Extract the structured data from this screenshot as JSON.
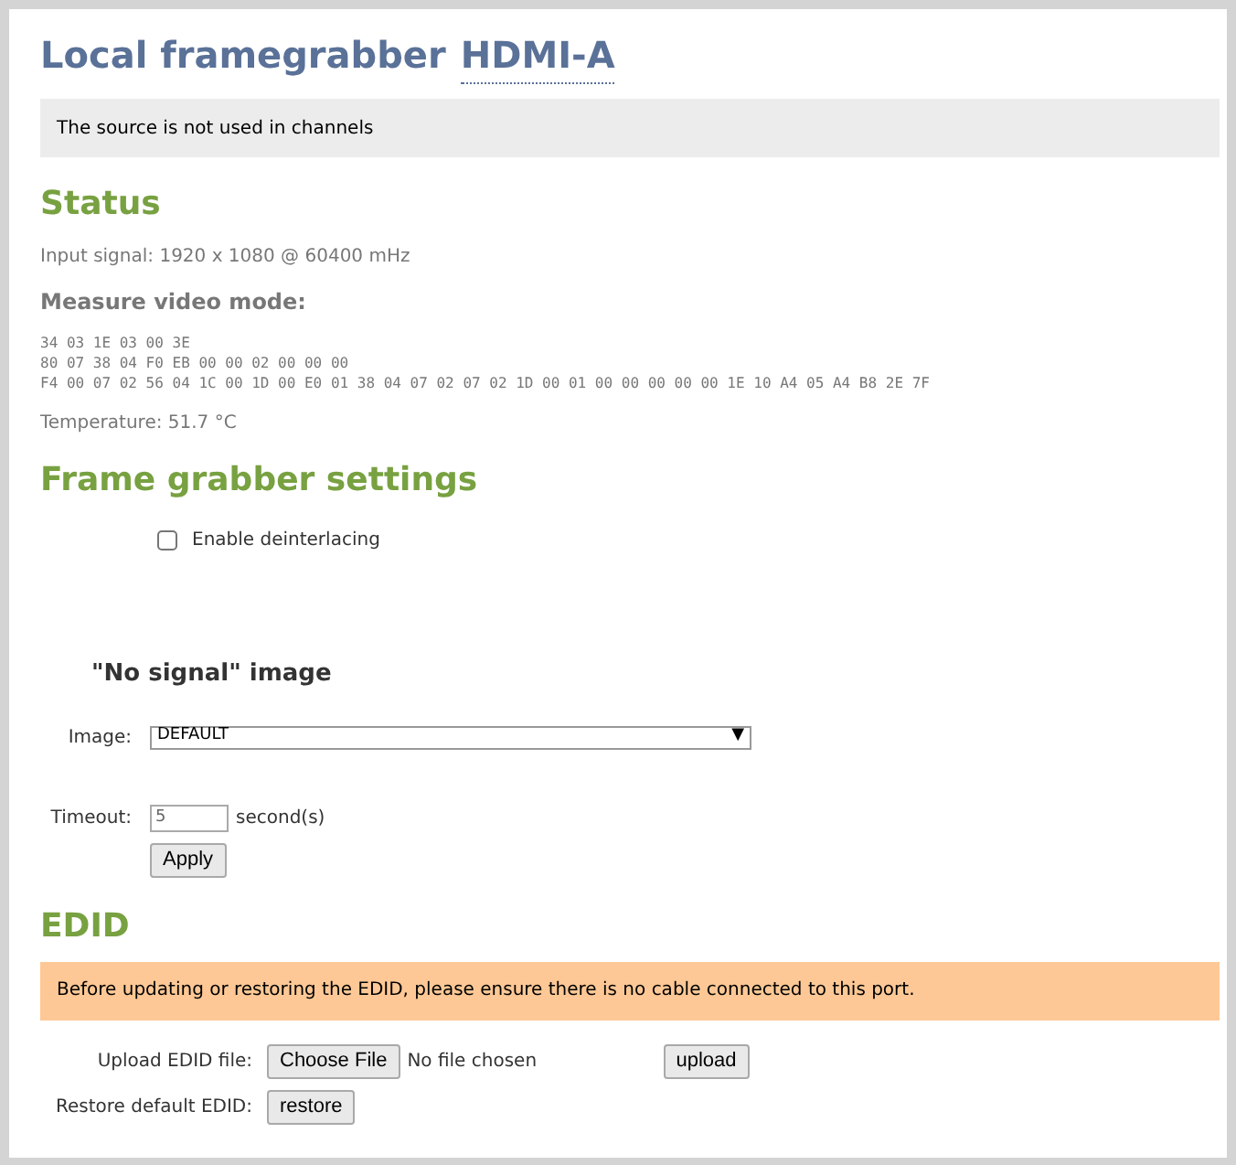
{
  "title": {
    "text": "Local framegrabber",
    "link": "HDMI-A"
  },
  "source_notice": "The source is not used in channels",
  "status": {
    "heading": "Status",
    "input_signal": "Input signal: 1920 x 1080 @ 60400 mHz",
    "measure_heading": "Measure video mode:",
    "video_mode_lines": [
      "34 03 1E 03 00 3E",
      "80 07 38 04 F0 EB 00 00 02 00 00 00",
      "F4 00 07 02 56 04 1C 00 1D 00 E0 01 38 04 07 02 07 02 1D 00 01 00 00 00 00 00 1E 10 A4 05 A4 B8 2E 7F"
    ],
    "temperature": "Temperature: 51.7 °C"
  },
  "settings": {
    "heading": "Frame grabber settings",
    "deinterlacing": {
      "label": "Enable deinterlacing",
      "checked": false
    },
    "no_signal_heading": "\"No signal\" image",
    "image": {
      "label": "Image:",
      "value": "DEFAULT",
      "arrow": "▼"
    },
    "timeout": {
      "label": "Timeout:",
      "value": "5",
      "unit": "second(s)"
    },
    "apply_button": "Apply"
  },
  "edid": {
    "heading": "EDID",
    "warning": "Before updating or restoring the EDID, please ensure there is no cable connected to this port.",
    "upload": {
      "label": "Upload EDID file:",
      "choose_button": "Choose File",
      "file_status": "No file chosen",
      "upload_button": "upload"
    },
    "restore": {
      "label": "Restore default EDID:",
      "restore_button": "restore"
    }
  }
}
